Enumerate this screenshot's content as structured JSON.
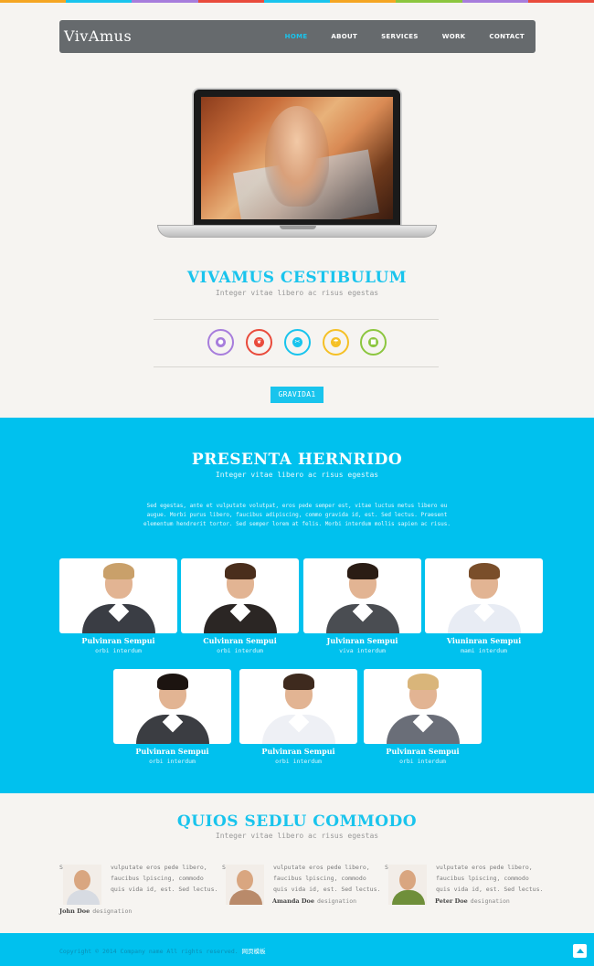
{
  "colors": {
    "accent": "#19c4ed",
    "section_bg": "#00c1ee",
    "navbar": "#666a6d",
    "page_bg": "#f6f4f1",
    "top_stripes": [
      "#f5a623",
      "#19c4ed",
      "#a77ddc",
      "#e94b3c",
      "#19c4ed",
      "#f5a623",
      "#8cc63f",
      "#a77ddc",
      "#e94b3c"
    ]
  },
  "nav": {
    "brand": "VivAmus",
    "links": [
      {
        "label": "HOME",
        "active": true
      },
      {
        "label": "ABOUT",
        "active": false
      },
      {
        "label": "SERVICES",
        "active": false
      },
      {
        "label": "WORK",
        "active": false
      },
      {
        "label": "CONTACT",
        "active": false
      }
    ]
  },
  "hero": {
    "title": "VIVAMUS CESTIBULUM",
    "subtitle": "Integer vitae libero ac risus egestas",
    "button": "GRAVIDA1",
    "icons": [
      {
        "name": "user-icon",
        "color": "#a77ddc",
        "glyph": "●"
      },
      {
        "name": "leaf-icon",
        "color": "#e94b3c",
        "glyph": "❦"
      },
      {
        "name": "tools-icon",
        "color": "#19c4ed",
        "glyph": "✂"
      },
      {
        "name": "umbrella-icon",
        "color": "#f5c026",
        "glyph": "☂"
      },
      {
        "name": "briefcase-icon",
        "color": "#8cc63f",
        "glyph": "■"
      }
    ]
  },
  "team": {
    "title": "PRESENTA HERNRIDO",
    "subtitle": "Integer vitae libero ac risus egestas",
    "description": "Sed egestas, ante et vulputate volutpat, eros pede semper est, vitae luctus metus libero eu augue. Morbi purus libero, faucibus adipiscing, commo gravida id, est. Sed lectus. Praesent elementum hendrerit tortor. Sed semper lorem at felis. Morbi interdum mollis sapien ac risus.",
    "members": [
      {
        "name": "Pulvinran Sempui",
        "role": "orbi interdum",
        "gender": "f",
        "suit": "#3a3d44",
        "hair": "#c9a06a"
      },
      {
        "name": "Culvinran Sempui",
        "role": "orbi interdum",
        "gender": "m",
        "suit": "#2b2624",
        "hair": "#4a2e1c"
      },
      {
        "name": "Julvinran Sempui",
        "role": "viva interdum",
        "gender": "f",
        "suit": "#4a4d52",
        "hair": "#2a1c14"
      },
      {
        "name": "Viuninran Sempui",
        "role": "mami interdum",
        "gender": "m",
        "suit": "#e8ecf4",
        "hair": "#7a4e2a"
      },
      {
        "name": "Pulvinran Sempui",
        "role": "orbi interdum",
        "gender": "f",
        "suit": "#3b3d42",
        "hair": "#1c1410"
      },
      {
        "name": "Pulvinran Sempui",
        "role": "orbi interdum",
        "gender": "m",
        "suit": "#eef0f5",
        "hair": "#3e2a1e"
      },
      {
        "name": "Pulvinran Sempui",
        "role": "orbi interdum",
        "gender": "f",
        "suit": "#6a6e78",
        "hair": "#d9b57a"
      }
    ]
  },
  "testimonials": {
    "title": "QUIOS SEDLU COMMODO",
    "subtitle": "Integer vitae libero ac risus egestas",
    "items": [
      {
        "lead": "Sed",
        "text": "vulputate eros pede libero, faucibus lpiscing, commodo quis vida id, est. Sed lectus.",
        "author": "John Doe",
        "designation": "designation",
        "shirt": "#d7dbe2"
      },
      {
        "lead": "Sed",
        "text": "vulputate eros pede libero, faucibus lpiscing, commodo quis vida id, est. Sed lectus.",
        "author": "Amanda Doe",
        "designation": "designation",
        "shirt": "#b98a6a"
      },
      {
        "lead": "Sed",
        "text": "vulputate eros pede libero, faucibus lpiscing, commodo quis vida id, est. Sed lectus.",
        "author": "Peter Doe",
        "designation": "designation",
        "shirt": "#6f8f3a"
      }
    ]
  },
  "footer": {
    "copyright": "Copyright © 2014 Company name All rights reserved.",
    "cn_link": "网页模板"
  }
}
